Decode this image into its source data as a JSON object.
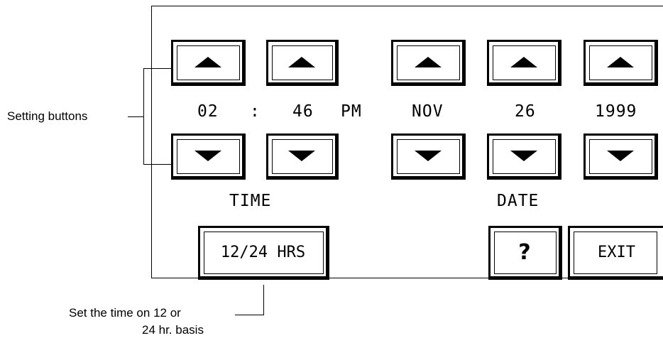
{
  "display": {
    "hour": "02",
    "separator": ":",
    "minute": "46",
    "ampm": "PM",
    "month": "NOV",
    "day": "26",
    "year": "1999",
    "time_label": "TIME",
    "date_label": "DATE"
  },
  "buttons": {
    "toggle_12_24": "12/24 HRS",
    "help": "?",
    "exit": "EXIT"
  },
  "annotations": {
    "setting_buttons": "Setting buttons",
    "hours_note_line1": "Set the time on 12 or",
    "hours_note_line2": "24 hr. basis"
  },
  "icons": {
    "up": "triangle-up-icon",
    "down": "triangle-down-icon"
  }
}
